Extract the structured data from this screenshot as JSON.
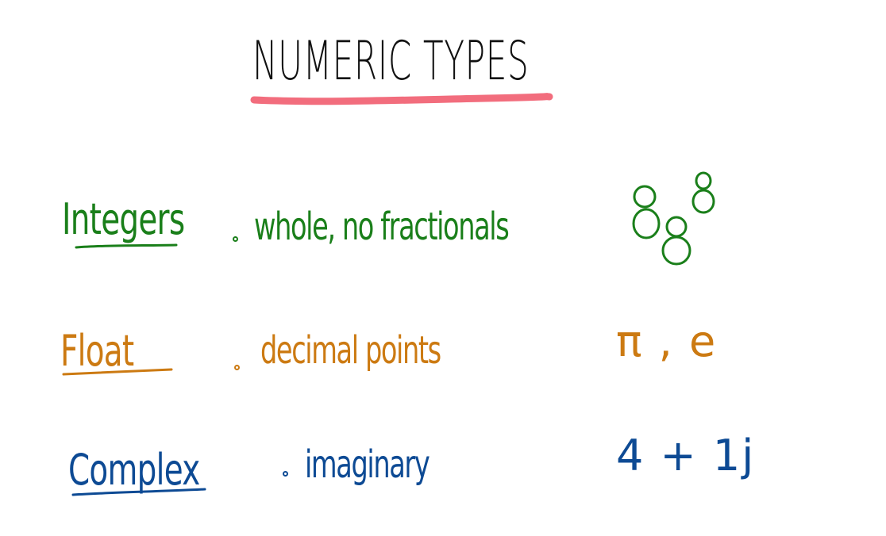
{
  "title": "NUMERIC TYPES",
  "colors": {
    "title_ink": "#111111",
    "title_underline": "#f26d7d",
    "integers": "#1a7f1a",
    "float": "#cc7a12",
    "complex": "#0d4a94"
  },
  "rows": [
    {
      "term": "Integers",
      "description": "whole, no fractionals",
      "example": "8 8 8"
    },
    {
      "term": "Float",
      "description": "decimal points",
      "example": "π , e"
    },
    {
      "term": "Complex",
      "description": "imaginary",
      "example": "4 + 1j"
    }
  ]
}
